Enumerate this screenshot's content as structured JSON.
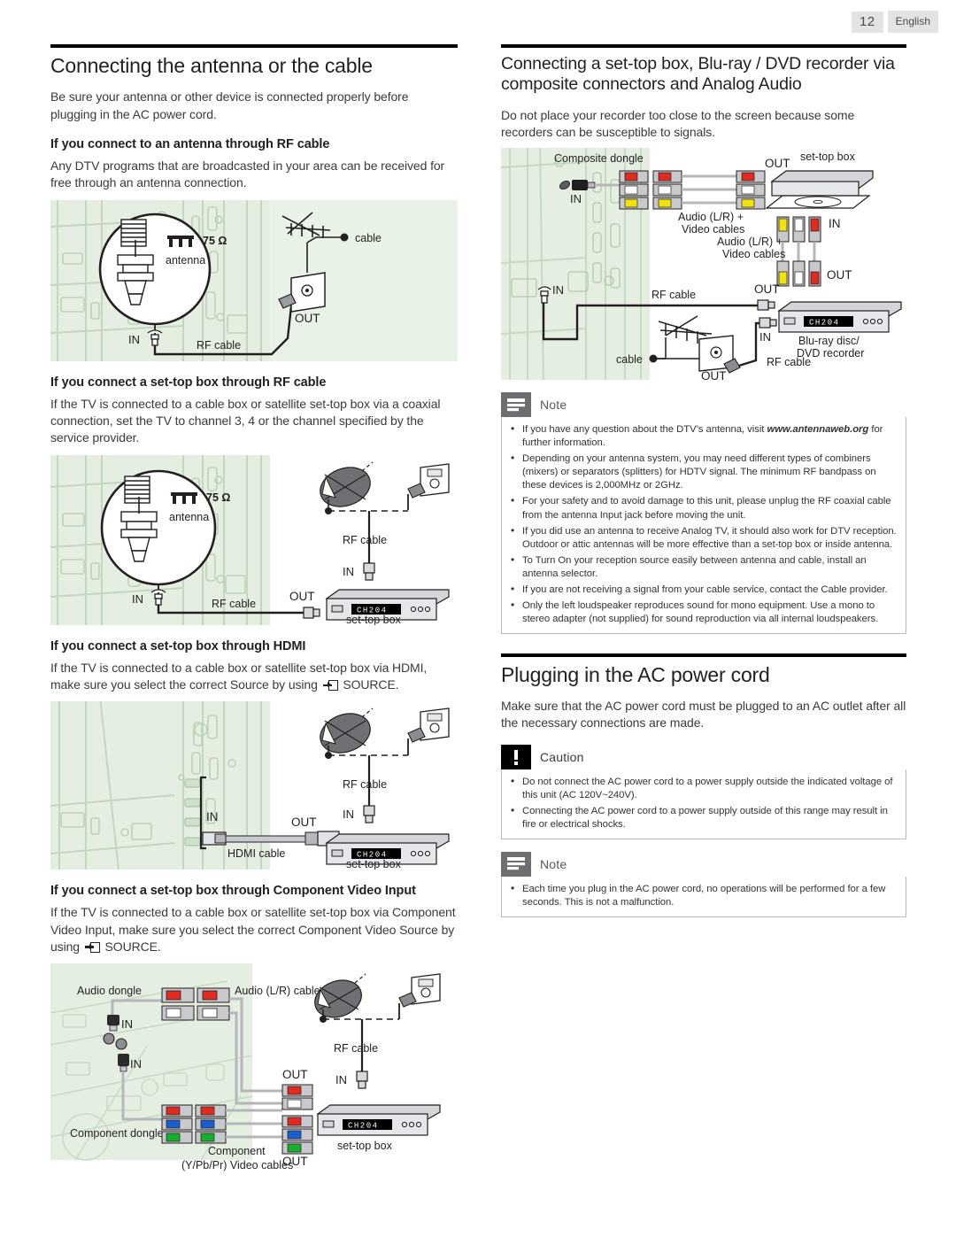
{
  "page": {
    "number": "12",
    "language": "English"
  },
  "left": {
    "section_title": "Connecting the antenna or the cable",
    "intro": "Be sure your antenna or other device is connected properly before plugging in the AC power cord.",
    "sub1": {
      "heading": "If you connect to an antenna through RF cable",
      "text": "Any DTV programs that are broadcasted in your area can be received for free through an antenna connection.",
      "figure": {
        "magnifier_impedance": "75 Ω",
        "magnifier_label": "antenna",
        "label_in": "IN",
        "label_rf": "RF cable",
        "label_out": "OUT",
        "label_cable": "cable"
      }
    },
    "sub2": {
      "heading": "If you connect a set-top box through RF cable",
      "text": "If the TV is connected to a cable box or satellite set-top box via a coaxial connection, set the TV to channel 3, 4 or the channel specified by the service provider.",
      "figure": {
        "magnifier_impedance": "75 Ω",
        "magnifier_label": "antenna",
        "label_in_tv": "IN",
        "label_rf_tv": "RF cable",
        "label_out": "OUT",
        "label_rf_dish": "RF cable",
        "label_in_stb": "IN",
        "device_label": "set-top box",
        "device_display": "CH204"
      }
    },
    "sub3": {
      "heading": "If you connect a set-top box through HDMI",
      "text_a": "If the TV is connected to a cable box or satellite set-top box via HDMI, make sure you select the correct Source by using ",
      "text_b": " SOURCE.",
      "figure": {
        "label_in_tv": "IN",
        "label_hdmi": "HDMI cable",
        "label_out": "OUT",
        "label_rf": "RF cable",
        "label_in_stb": "IN",
        "device_label": "set-top box",
        "device_display": "CH204"
      }
    },
    "sub4": {
      "heading": "If you connect a set-top box through Component Video Input",
      "text_a": "If the TV is connected to a cable box or satellite set-top box via Component Video Input, make sure you select the correct Component Video Source by using ",
      "text_b": " SOURCE.",
      "figure": {
        "label_audio_dongle": "Audio dongle",
        "label_audio_cables": "Audio (L/R) cables",
        "label_in_audio": "IN",
        "label_in_comp": "IN",
        "label_component_dongle": "Component dongle",
        "label_component_cables_1": "Component",
        "label_component_cables_2": "(Y/Pb/Pr) Video cables",
        "label_out_audio": "OUT",
        "label_out_comp": "OUT",
        "label_rf": "RF cable",
        "label_in_stb": "IN",
        "device_label": "set-top box",
        "device_display": "CH204"
      }
    }
  },
  "right": {
    "section_title_line1": "Connecting a set-top box, Blu-ray / DVD recorder via",
    "section_title_line2": "composite connectors and Analog Audio",
    "intro": "Do not place your recorder too close to the screen because some recorders can be susceptible to signals.",
    "figure": {
      "label_composite_dongle": "Composite dongle",
      "label_in_composite": "IN",
      "label_av_cables_1_a": "Audio (L/R) +",
      "label_av_cables_1_b": "Video cables",
      "label_out_stb": "OUT",
      "label_stb": "set-top box",
      "label_in_bd": "IN",
      "label_av_cables_2_a": "Audio (L/R) +",
      "label_av_cables_2_b": "Video cables",
      "label_out_bd_av": "OUT",
      "label_in_tv_rf": "IN",
      "label_rf_top": "RF cable",
      "label_out_rf": "OUT",
      "label_in_rf_bd": "IN",
      "label_bd_1": "Blu-ray disc/",
      "label_bd_2": "DVD recorder",
      "label_cable": "cable",
      "label_out_wall": "OUT",
      "label_rf_bottom": "RF cable",
      "device_display": "CH204"
    },
    "note1": {
      "title": "Note",
      "items": [
        "If you have any question about the DTV’s antenna, visit www.antennaweb.org for further information.",
        "Depending on your antenna system, you may need different types of combiners (mixers) or separators (splitters) for HDTV signal. The minimum RF bandpass on these devices is 2,000MHz or 2GHz.",
        "For your safety and to avoid damage to this unit, please unplug the RF coaxial cable from the antenna Input jack before moving the unit.",
        "If you did use an antenna to receive Analog TV, it should also work for DTV reception. Outdoor or attic antennas will be more effective than a set-top box or inside antenna.",
        "To Turn On your reception source easily between antenna and cable, install an antenna selector.",
        "If you are not receiving a signal from your cable service, contact the Cable provider.",
        "Only the left loudspeaker reproduces sound for mono equipment. Use a mono to stereo adapter (not supplied) for sound reproduction via all internal loudspeakers."
      ],
      "emphasis": "www.antennaweb.org"
    },
    "section2_title": "Plugging in the AC power cord",
    "section2_intro": "Make sure that the AC power cord must be plugged to an AC outlet after all the necessary connections are made.",
    "caution": {
      "title": "Caution",
      "items": [
        "Do not connect the AC power cord to a power supply outside the indicated voltage of this unit (AC 120V~240V).",
        "Connecting the AC power cord to a power supply outside of this range may result in fire or electrical shocks."
      ]
    },
    "note2": {
      "title": "Note",
      "items": [
        "Each time you plug in the AC power cord, no operations will be performed for a few seconds. This is not a malfunction."
      ]
    }
  },
  "colors": {
    "figure_bg": "#e8f2e6",
    "rule": "#000000",
    "note_icon_bg": "#6d6e71",
    "caution_icon_bg": "#000000"
  }
}
